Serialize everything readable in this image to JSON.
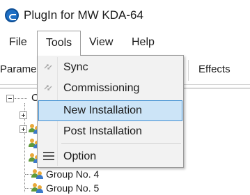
{
  "window": {
    "title": "PlugIn for MW KDA-64"
  },
  "menubar": {
    "file": "File",
    "tools": "Tools",
    "view": "View",
    "help": "Help"
  },
  "tabs": {
    "left_partial": "Parame",
    "right": "Effects"
  },
  "tools_menu": {
    "items": [
      {
        "label": "Sync",
        "icon": "sync-icon"
      },
      {
        "label": "Commissioning",
        "icon": "commissioning-icon"
      },
      {
        "label": "New Installation",
        "icon": "",
        "highlighted": true
      },
      {
        "label": "Post Installation",
        "icon": ""
      },
      {
        "label": "Option",
        "icon": "option-list-icon"
      }
    ]
  },
  "tree": {
    "root_partial": "C",
    "groups": [
      {
        "label": "Group No. 4"
      },
      {
        "label": "Group No. 5"
      }
    ]
  },
  "colors": {
    "highlight": "#cce4f7",
    "highlight_border": "#3f8fd2",
    "app_icon": "#1e6fc4"
  }
}
